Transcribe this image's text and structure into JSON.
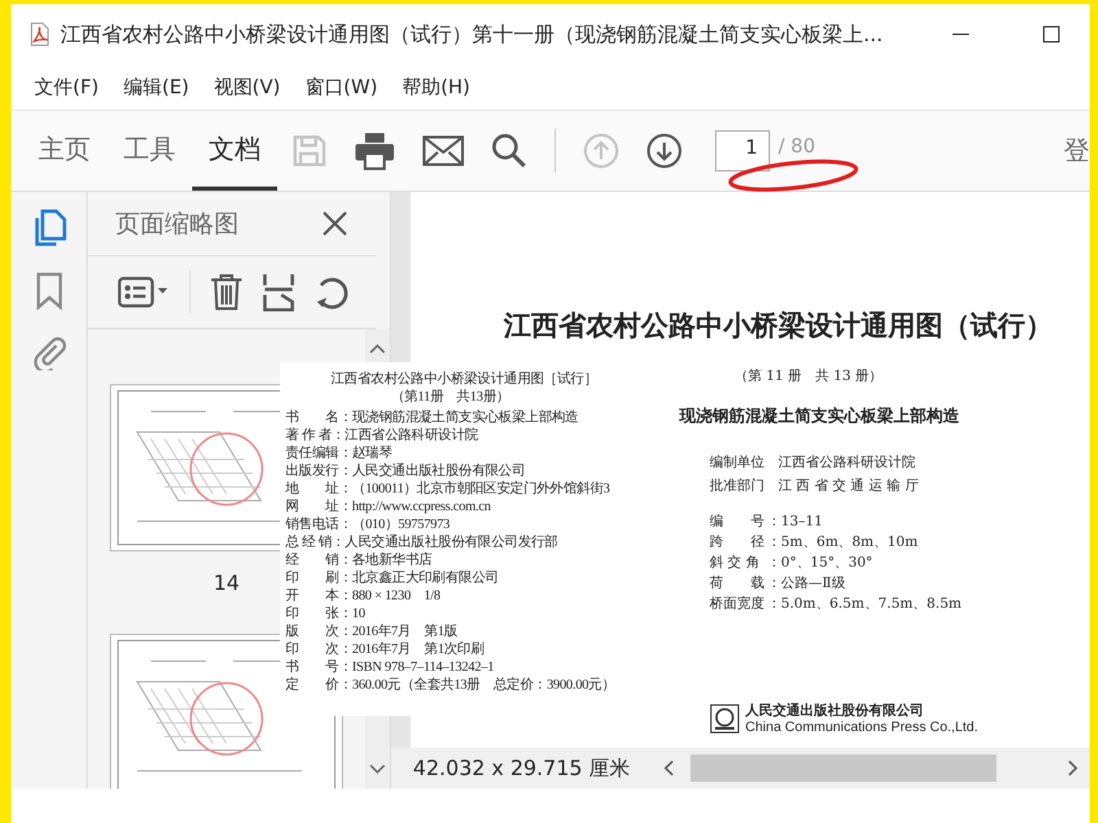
{
  "window": {
    "title": "江西省农村公路中小桥梁设计通用图（试行）第十一册（现浇钢筋混凝土简支实心板梁上..."
  },
  "menu": [
    "文件(F)",
    "编辑(E)",
    "视图(V)",
    "窗口(W)",
    "帮助(H)"
  ],
  "tabs": [
    {
      "label": "主页",
      "selected": false
    },
    {
      "label": "工具",
      "selected": false
    },
    {
      "label": "文档",
      "selected": true
    }
  ],
  "page_nav": {
    "current": "1",
    "total": "/ 80"
  },
  "toolbar_cut_text": "登",
  "thumbnail_panel": {
    "title": "页面缩略图",
    "thumbnails": [
      {
        "label": "14"
      }
    ],
    "next_thumbnail_partly_shown": true
  },
  "document_page": {
    "title": "江西省农村公路中小桥梁设计通用图（试行）",
    "volume": "（第 11 册　共 13 册）",
    "heading": "现浇钢筋混凝土简支实心板梁上部构造",
    "credits": [
      {
        "label": "编制单位",
        "value": "江西省公路科研设计院"
      },
      {
        "label": "批准部门",
        "value": "江 西 省 交 通 运 输 厅"
      }
    ],
    "specs": [
      {
        "label": "编　　号",
        "value": "：13–11"
      },
      {
        "label": "跨　　径",
        "value": "：5m、6m、8m、10m"
      },
      {
        "label": "斜 交 角",
        "value": "：0°、15°、30°"
      },
      {
        "label": "荷　　载",
        "value": "：公路—Ⅱ级"
      },
      {
        "label": "桥面宽度",
        "value": "：5.0m、6.5m、7.5m、8.5m"
      }
    ],
    "publisher": {
      "name": "人民交通出版社股份有限公司",
      "english": "China Communications Press  Co.,Ltd."
    }
  },
  "copyright_page": {
    "title": "江西省农村公路中小桥梁设计通用图［试行］",
    "volume": "（第11册　共13册）",
    "rows": [
      {
        "label": "书　　名",
        "value": "：现浇钢筋混凝土简支实心板梁上部构造"
      },
      {
        "label": "著 作 者",
        "value": "：江西省公路科研设计院"
      },
      {
        "label": "责任编辑",
        "value": "：赵瑞琴"
      },
      {
        "label": "出版发行",
        "value": "：人民交通出版社股份有限公司"
      },
      {
        "label": "地　　址",
        "value": "：（100011）北京市朝阳区安定门外外馆斜街3"
      },
      {
        "label": "网　　址",
        "value": "：http://www.ccpress.com.cn"
      },
      {
        "label": "销售电话",
        "value": "：（010）59757973"
      },
      {
        "label": "总 经 销",
        "value": "：人民交通出版社股份有限公司发行部"
      },
      {
        "label": "经　　销",
        "value": "：各地新华书店"
      },
      {
        "label": "印　　刷",
        "value": "：北京鑫正大印刷有限公司"
      },
      {
        "label": "开　　本",
        "value": "：880 × 1230　1/8"
      },
      {
        "label": "印　　张",
        "value": "：10"
      },
      {
        "label": "版　　次",
        "value": "：2016年7月　第1版"
      },
      {
        "label": "印　　次",
        "value": "：2016年7月　第1次印刷"
      },
      {
        "label": "书　　号",
        "value": "：ISBN 978–7–114–13242–1"
      },
      {
        "label": "定　　价",
        "value": "：360.00元（全套共13册　总定价：3900.00元）"
      }
    ]
  },
  "status_bar": {
    "page_size": "42.032 x 29.715 厘米"
  }
}
